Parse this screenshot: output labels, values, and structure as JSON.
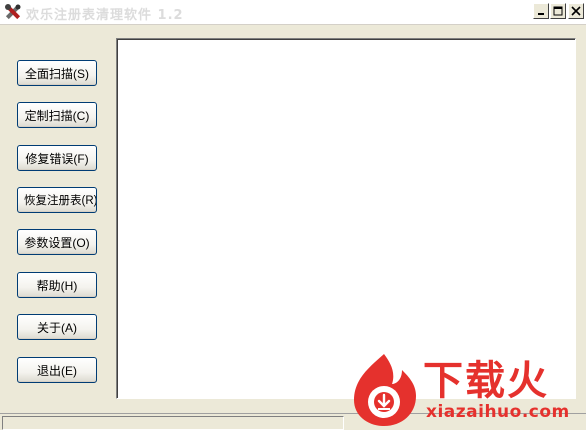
{
  "window": {
    "title": "欢乐注册表清理软件 1.2"
  },
  "sidebar": {
    "buttons": [
      {
        "label": "全面扫描(S)"
      },
      {
        "label": "定制扫描(C)"
      },
      {
        "label": "修复错误(F)"
      },
      {
        "label": "恢复注册表(R)"
      },
      {
        "label": "参数设置(O)"
      },
      {
        "label": "帮助(H)"
      },
      {
        "label": "关于(A)"
      },
      {
        "label": "退出(E)"
      }
    ]
  },
  "watermark": {
    "brand": "下载火",
    "domain": "xiazaihuo.com"
  },
  "colors": {
    "watermark": "#e5312d",
    "button_border": "#003c74",
    "window_bg": "#ece9d8"
  }
}
